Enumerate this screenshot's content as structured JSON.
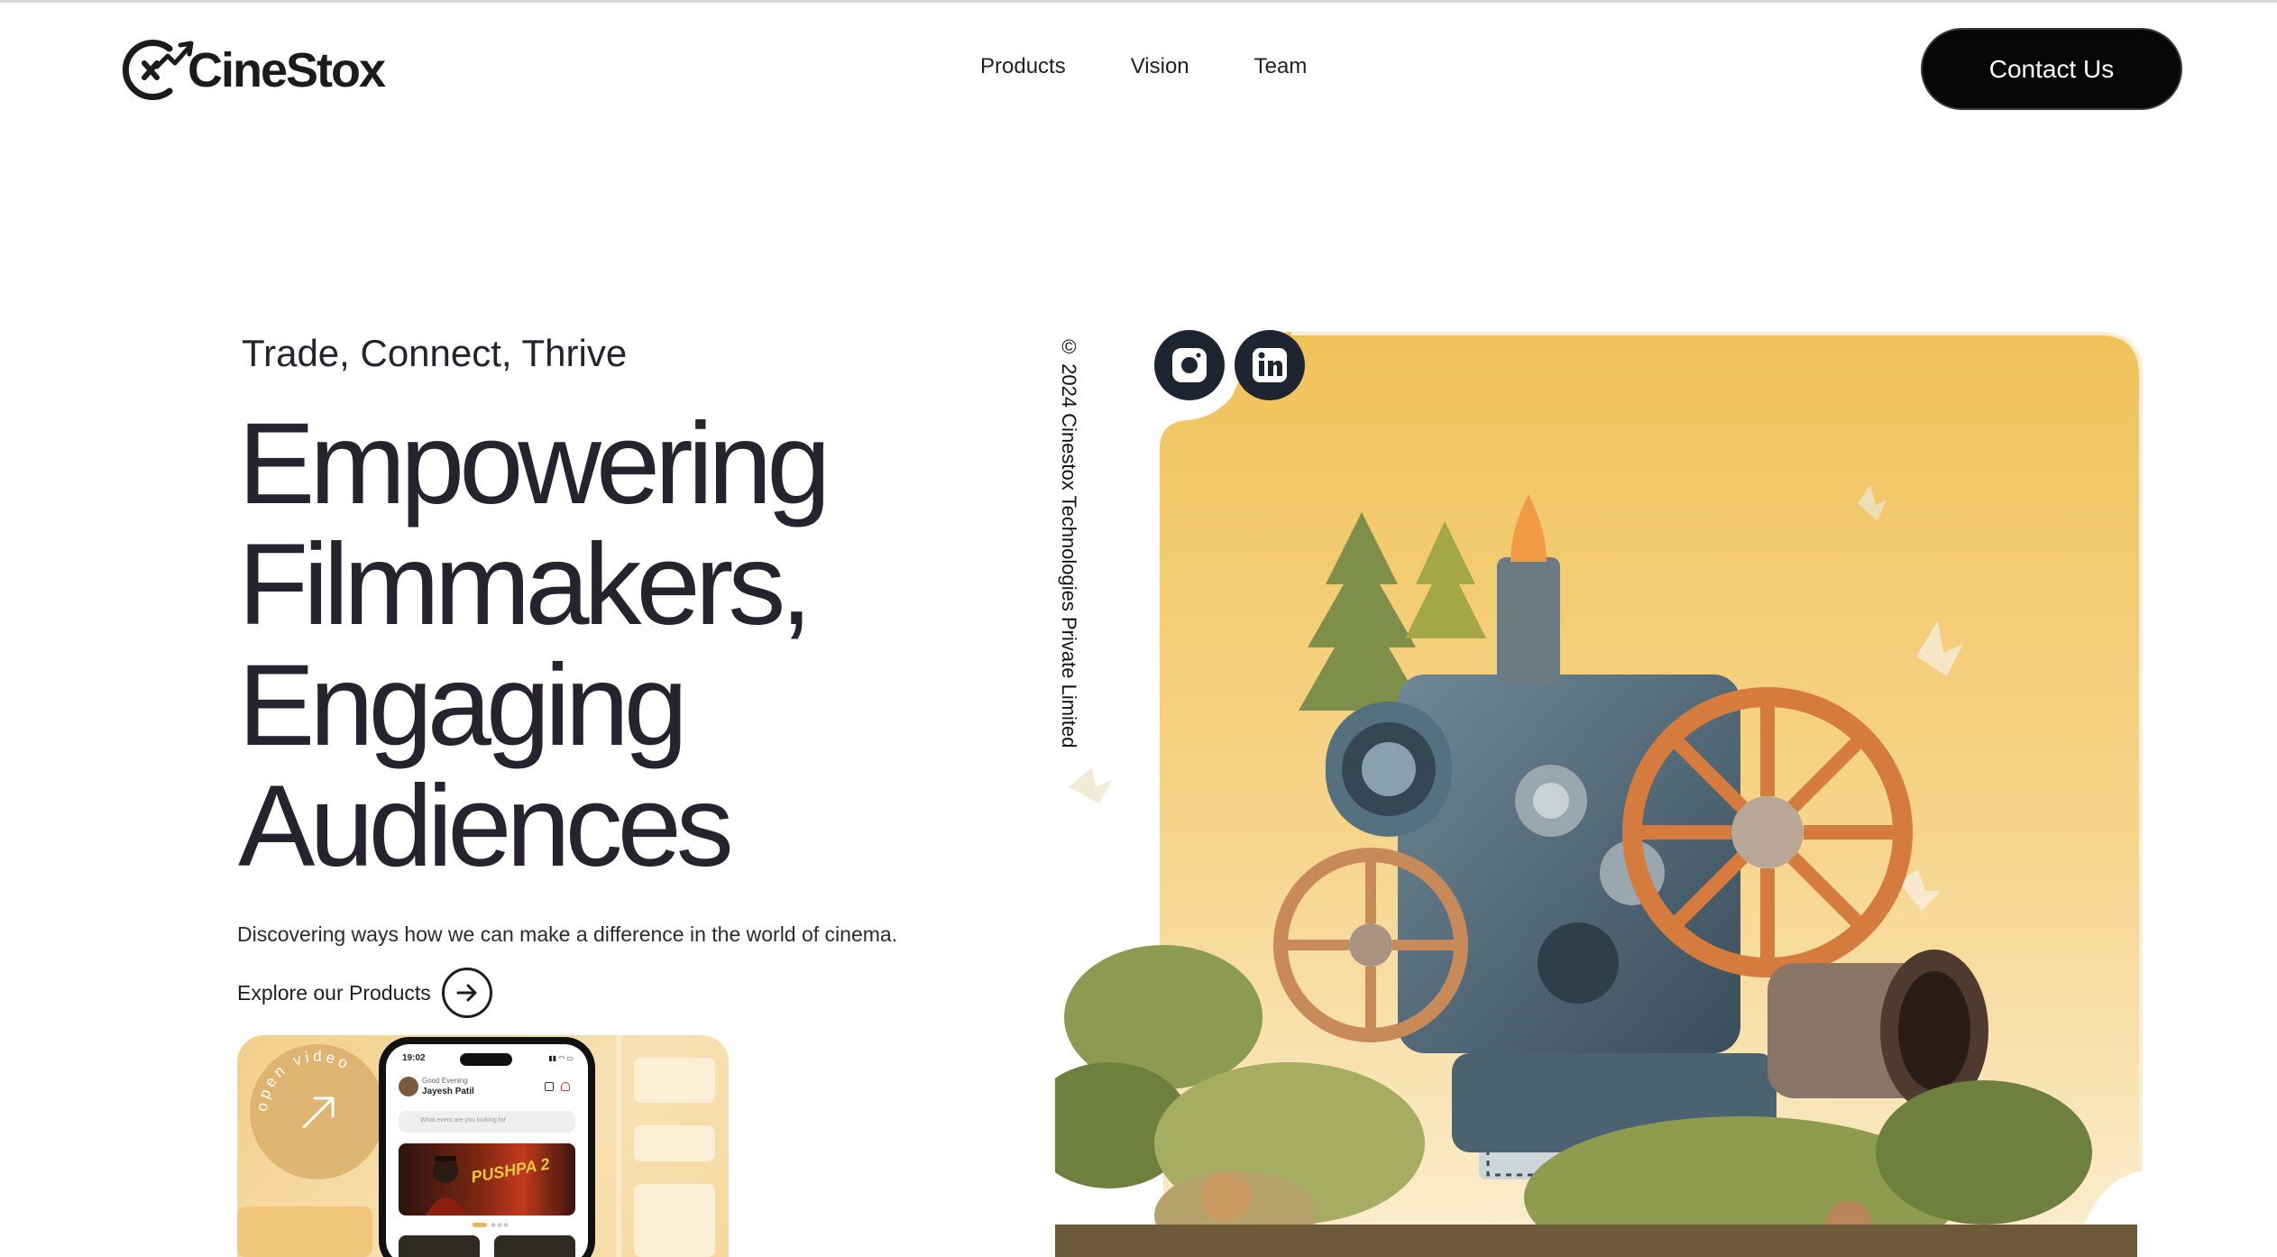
{
  "brand": {
    "name": "CineStox"
  },
  "nav": {
    "items": [
      "Products",
      "Vision",
      "Team"
    ]
  },
  "header": {
    "cta_label": "Contact Us"
  },
  "hero": {
    "tagline": "Trade, Connect, Thrive",
    "headline_lines": [
      "Empowering",
      "Filmmakers,",
      "Engaging",
      "Audiences"
    ],
    "subtext": "Discovering ways how we can make a difference in the world of cinema.",
    "explore_label": "Explore our Products"
  },
  "side": {
    "copyright": "© 2024 Cinestox Technologies Private Limited"
  },
  "social": {
    "icons": [
      "instagram-icon",
      "linkedin-icon"
    ]
  },
  "promo": {
    "badge_text": "open video",
    "phone": {
      "time": "19:02",
      "greeting": "Good Evening",
      "user_name": "Jayesh Patil",
      "search_placeholder": "What event are you looking for",
      "poster_title": "PUSHPA 2"
    }
  },
  "colors": {
    "text_dark": "#26222e",
    "button_bg": "#070707",
    "social_bg": "#1d2530",
    "art_gold": "#f0c25a",
    "art_cream": "#fbeed1"
  }
}
